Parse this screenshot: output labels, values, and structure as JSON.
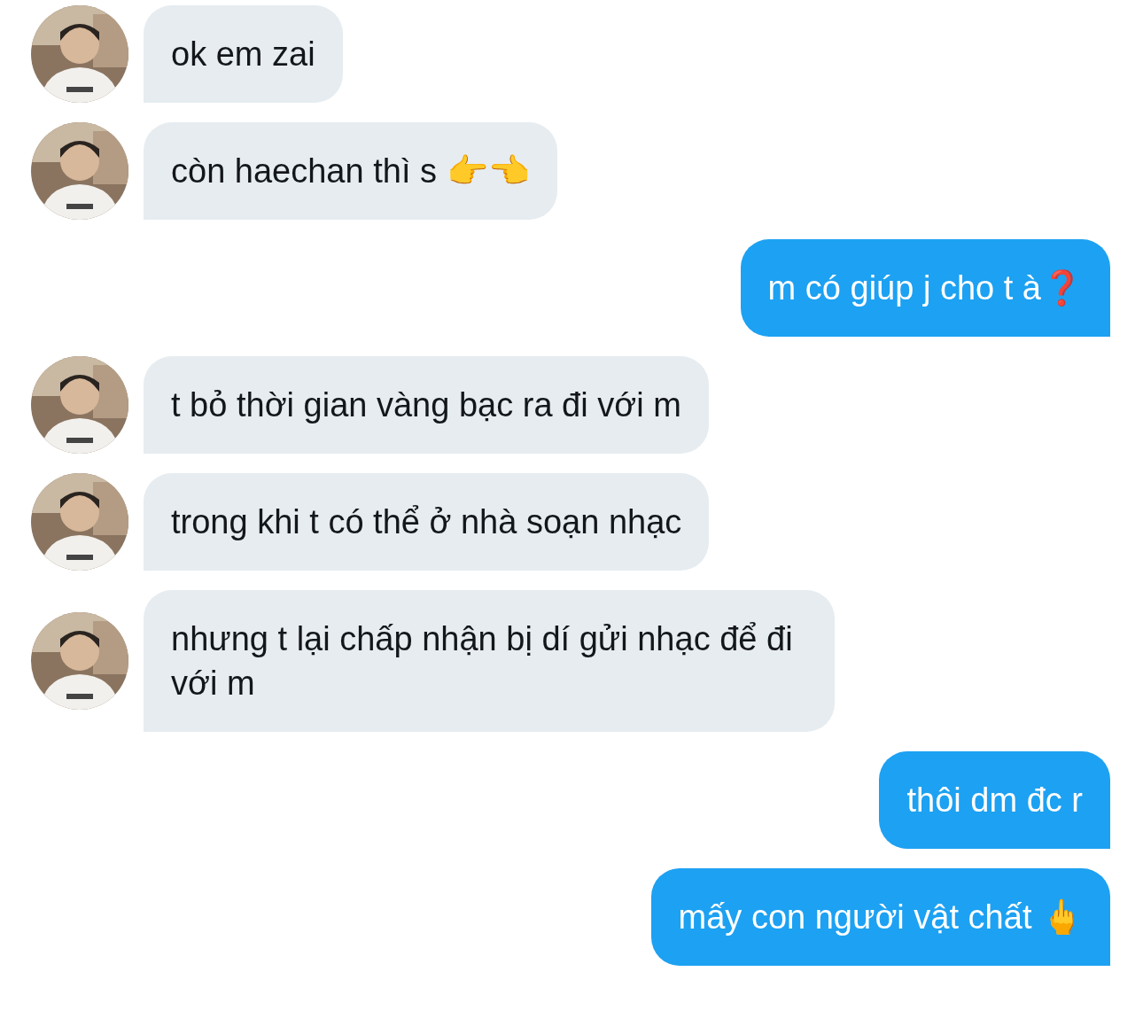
{
  "messages": [
    {
      "kind": "incoming",
      "text": "ok em zai"
    },
    {
      "kind": "incoming",
      "text": "còn haechan thì s 👉👈"
    },
    {
      "kind": "outgoing",
      "text": "m có giúp j cho t à❓"
    },
    {
      "kind": "incoming",
      "text": "t bỏ thời gian vàng bạc ra đi với m"
    },
    {
      "kind": "incoming",
      "text": "trong khi t có thể ở nhà soạn nhạc"
    },
    {
      "kind": "incoming",
      "text": "nhưng t lại chấp nhận bị dí gửi nhạc để đi với m"
    },
    {
      "kind": "outgoing",
      "text": "thôi dm đc r"
    },
    {
      "kind": "outgoing",
      "text": "mấy con người vật chất 🖕"
    }
  ]
}
